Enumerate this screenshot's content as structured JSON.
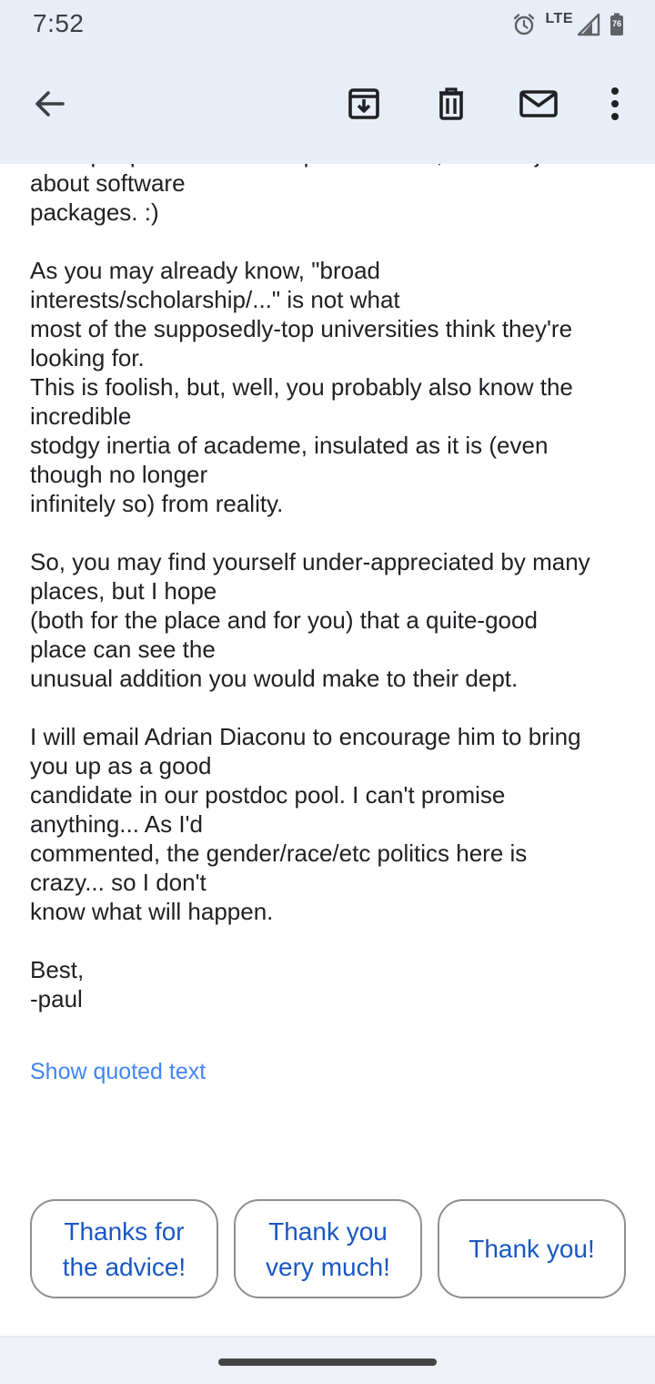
{
  "status_bar": {
    "time": "7:52",
    "network": "LTE",
    "battery_level": "76",
    "icons": [
      "alarm-icon",
      "signal-icon",
      "battery-icon"
    ]
  },
  "app_bar": {
    "back": "arrow-back-icon",
    "actions": [
      "archive-icon",
      "delete-icon",
      "mark-unread-icon",
      "more-vert-icon"
    ]
  },
  "email": {
    "lines": [
      "more people who are computer-literate, and not just",
      "about software",
      "packages. :)",
      "",
      "As you may already know, \"broad",
      "interests/scholarship/...\" is not what",
      "most of the supposedly-top universities think they're",
      "looking for.",
      "This is foolish, but, well, you probably also know the",
      "incredible",
      "stodgy inertia of academe, insulated as it is (even",
      "though no longer",
      "infinitely so) from reality.",
      "",
      "So, you may find yourself under-appreciated by many",
      "places, but I hope",
      "(both for the place and for you) that a quite-good",
      "place can see the",
      "unusual addition you would make to their dept.",
      "",
      "I will email Adrian Diaconu to encourage him to bring",
      "you up as a good",
      "candidate in our postdoc pool. I can't promise",
      "anything... As I'd",
      "commented, the gender/race/etc politics here is",
      "crazy... so I don't",
      "know what will happen.",
      "",
      "Best,",
      "-paul"
    ],
    "show_quoted_text": "Show quoted text"
  },
  "smart_replies": [
    "Thanks for\nthe advice!",
    "Thank you\nvery much!",
    "Thank you!"
  ],
  "colors": {
    "app_bar_background": "#e8eef8",
    "link": "#4285f4",
    "chip_text": "#1a57c5"
  }
}
